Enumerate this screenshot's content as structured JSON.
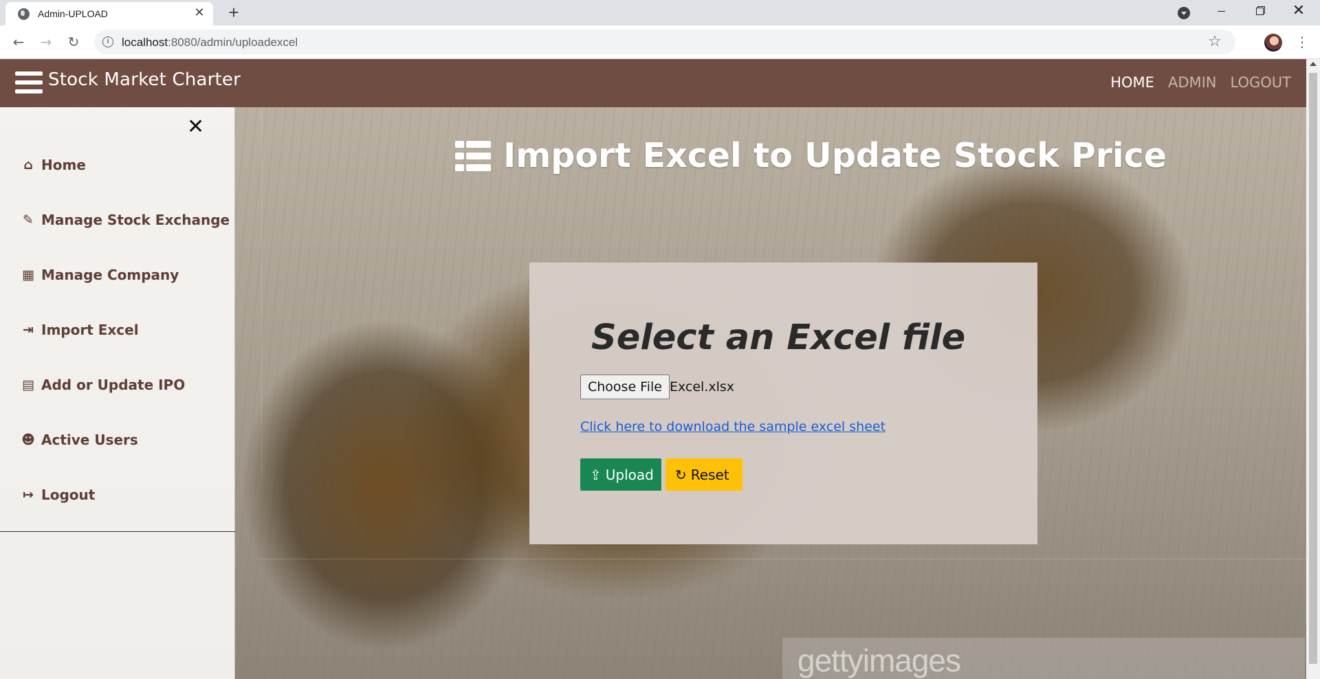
{
  "browser": {
    "tab_title": "Admin-UPLOAD",
    "url_host": "localhost",
    "url_path": ":8080/admin/uploadexcel"
  },
  "navbar": {
    "brand": "Stock Market Charter",
    "links": [
      {
        "label": "HOME",
        "active": true
      },
      {
        "label": "ADMIN",
        "active": false
      },
      {
        "label": "LOGOUT",
        "active": false
      }
    ]
  },
  "sidebar": {
    "close_symbol": "✕",
    "items": [
      {
        "label": "Home",
        "icon": "home-icon"
      },
      {
        "label": "Manage Stock Exchange",
        "icon": "edit-icon"
      },
      {
        "label": "Manage Company",
        "icon": "building-icon"
      },
      {
        "label": "Import Excel",
        "icon": "file-import-icon"
      },
      {
        "label": "Add or Update IPO",
        "icon": "clipboard-icon"
      },
      {
        "label": "Active Users",
        "icon": "users-icon"
      },
      {
        "label": "Logout",
        "icon": "sign-out-icon"
      }
    ]
  },
  "main": {
    "heading": "Import Excel to Update Stock Price",
    "card": {
      "title": "Select an Excel file",
      "file_button": "Choose File",
      "file_name": "Excel.xlsx",
      "sample_link": "Click here to download the sample excel sheet",
      "upload_label": "Upload",
      "reset_label": "Reset"
    }
  },
  "watermark": "gettyimages",
  "colors": {
    "navbar": "#704d42",
    "upload": "#198754",
    "reset": "#ffc107",
    "link": "#1a5cd6"
  }
}
